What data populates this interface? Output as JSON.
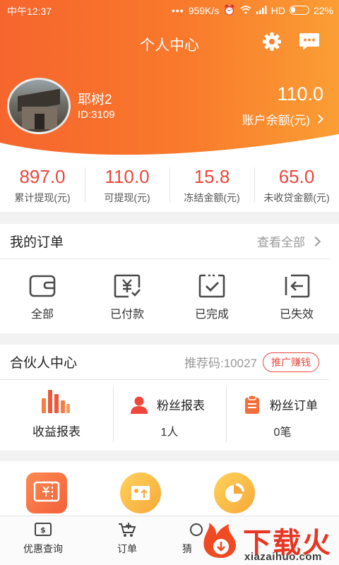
{
  "status_bar": {
    "time": "中午12:37",
    "speed": "959K/s",
    "network": "HD",
    "battery": "22%"
  },
  "header": {
    "title": "个人中心"
  },
  "user": {
    "name": "耶树2",
    "id": "ID:3109"
  },
  "account": {
    "balance": "110.0",
    "balance_label": "账户余额(元)"
  },
  "stats": [
    {
      "value": "897.0",
      "label": "累计提现(元)"
    },
    {
      "value": "110.0",
      "label": "可提现(元)"
    },
    {
      "value": "15.8",
      "label": "冻结金额(元)"
    },
    {
      "value": "65.0",
      "label": "未收贷金额(元)"
    }
  ],
  "orders": {
    "title": "我的订单",
    "view_all": "查看全部",
    "items": [
      {
        "label": "全部",
        "icon": "wallet-icon"
      },
      {
        "label": "已付款",
        "icon": "yuan-paid-icon"
      },
      {
        "label": "已完成",
        "icon": "completed-check-icon"
      },
      {
        "label": "已失效",
        "icon": "expired-exit-icon"
      }
    ]
  },
  "partner": {
    "title": "合伙人中心",
    "ref_code": "推荐码:10027",
    "promo_button": "推广赚钱",
    "income": {
      "label": "收益报表"
    },
    "fans_report": {
      "title": "粉丝报表",
      "value": "1人"
    },
    "fans_orders": {
      "title": "粉丝订单",
      "value": "0笔"
    }
  },
  "bottom_nav": [
    {
      "label": "优惠查询",
      "icon": "coupon-search-icon"
    },
    {
      "label": "订单",
      "icon": "cart-icon"
    },
    {
      "label": "猜",
      "icon": "guess-icon"
    }
  ],
  "watermark": {
    "text": "下载火",
    "url": "xiazaihuo.com"
  },
  "colors": {
    "accent": "#e8483c",
    "header_start": "#f6652d",
    "header_end": "#fb9e34"
  }
}
